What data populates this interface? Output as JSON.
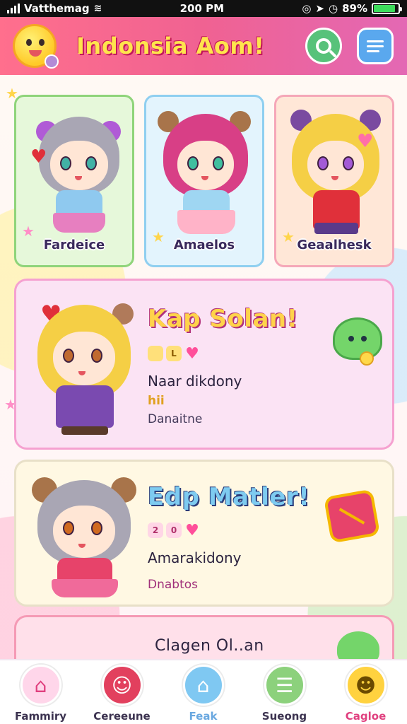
{
  "status_bar": {
    "carrier": "Vatthemag",
    "time": "200 PM",
    "battery": "89%",
    "battery_level": 0.89
  },
  "header": {
    "title": "Indonsia Aom!",
    "logo_icon": "smiley-mascot-icon",
    "search_icon": "search-icon",
    "edit_icon": "edit-icon"
  },
  "characters": [
    {
      "name": "Fardeice",
      "accent": "#8fd47a",
      "bg": "#e6f8da"
    },
    {
      "name": "Amaelos",
      "accent": "#8fcff0",
      "bg": "#e3f4fd"
    },
    {
      "name": "Geaalhesk",
      "accent": "#f5a7b8",
      "bg": "#ffe7d7"
    }
  ],
  "profiles": [
    {
      "headline": "Kap Solan!",
      "badges": [
        "",
        "L"
      ],
      "line1": "Naar dikdony",
      "line2": "hii",
      "line3": "Danaitne",
      "border": "#f5a1d0",
      "bg": "#fbe3f4"
    },
    {
      "headline": "Edp Matler!",
      "badges": [
        "2",
        "0"
      ],
      "line1": "Amarakidony",
      "line3": "Dnabtos",
      "border": "#e8e0c8",
      "bg": "#fff8e3"
    }
  ],
  "peek_card": {
    "headline": "Clagen Ol..an"
  },
  "bottom_nav": [
    {
      "label": "Fammiry",
      "icon": "home-icon",
      "color": "#ff8fc2"
    },
    {
      "label": "Cereeune",
      "icon": "character-icon",
      "color": "#e2405e"
    },
    {
      "label": "Feak",
      "icon": "home-icon",
      "color": "#7fc8f2"
    },
    {
      "label": "Sueong",
      "icon": "list-icon",
      "color": "#8cd17c"
    },
    {
      "label": "Cagloe",
      "icon": "smiley-icon",
      "color": "#ffd23f"
    }
  ],
  "active_nav": "Cagloe"
}
